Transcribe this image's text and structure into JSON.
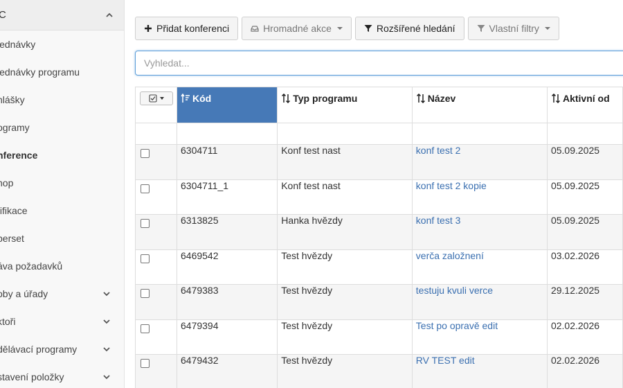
{
  "sidebar": {
    "header_label": "C",
    "items": [
      {
        "label": "jednávky",
        "chevron": false,
        "active": false
      },
      {
        "label": "jednávky programu",
        "chevron": false,
        "active": false
      },
      {
        "label": "hlášky",
        "chevron": false,
        "active": false
      },
      {
        "label": "ogramy",
        "chevron": false,
        "active": false
      },
      {
        "label": "nference",
        "chevron": false,
        "active": true
      },
      {
        "label": "hop",
        "chevron": false,
        "active": false
      },
      {
        "label": "tifikace",
        "chevron": false,
        "active": false
      },
      {
        "label": "perset",
        "chevron": false,
        "active": false
      },
      {
        "label": "áva požadavků",
        "chevron": false,
        "active": false
      },
      {
        "label": "oby a úřady",
        "chevron": true,
        "active": false
      },
      {
        "label": "ktoři",
        "chevron": true,
        "active": false
      },
      {
        "label": "dělávací programy",
        "chevron": true,
        "active": false
      },
      {
        "label": "stavení položky",
        "chevron": true,
        "active": false
      }
    ]
  },
  "toolbar": {
    "add_label": "Přidat konferenci",
    "bulk_label": "Hromadné akce",
    "advanced_label": "Rozšířené hledání",
    "filters_label": "Vlastní filtry"
  },
  "search": {
    "placeholder": "Vyhledat..."
  },
  "table": {
    "columns": [
      "Kód",
      "Typ programu",
      "Název",
      "Aktivní od"
    ],
    "rows": [
      {
        "kod": "6304711",
        "typ": "Konf test nast",
        "nazev": "konf test 2",
        "od": "05.09.2025"
      },
      {
        "kod": "6304711_1",
        "typ": "Konf test nast",
        "nazev": "konf test 2 kopie",
        "od": "05.09.2025"
      },
      {
        "kod": "6313825",
        "typ": "Hanka hvězdy",
        "nazev": "konf test 3",
        "od": "05.09.2025"
      },
      {
        "kod": "6469542",
        "typ": "Test hvězdy",
        "nazev": "verča založnení",
        "od": "03.02.2026"
      },
      {
        "kod": "6479383",
        "typ": "Test hvězdy",
        "nazev": "testuju kvuli verce",
        "od": "29.12.2025"
      },
      {
        "kod": "6479394",
        "typ": "Test hvězdy",
        "nazev": "Test po opravě edit",
        "od": "02.02.2026"
      },
      {
        "kod": "6479432",
        "typ": "Test hvězdy",
        "nazev": "RV TEST edit",
        "od": "02.02.2026"
      }
    ]
  },
  "colors": {
    "accent": "#4679b7",
    "link": "#3a6fb0",
    "focus": "#5b9dd9"
  }
}
